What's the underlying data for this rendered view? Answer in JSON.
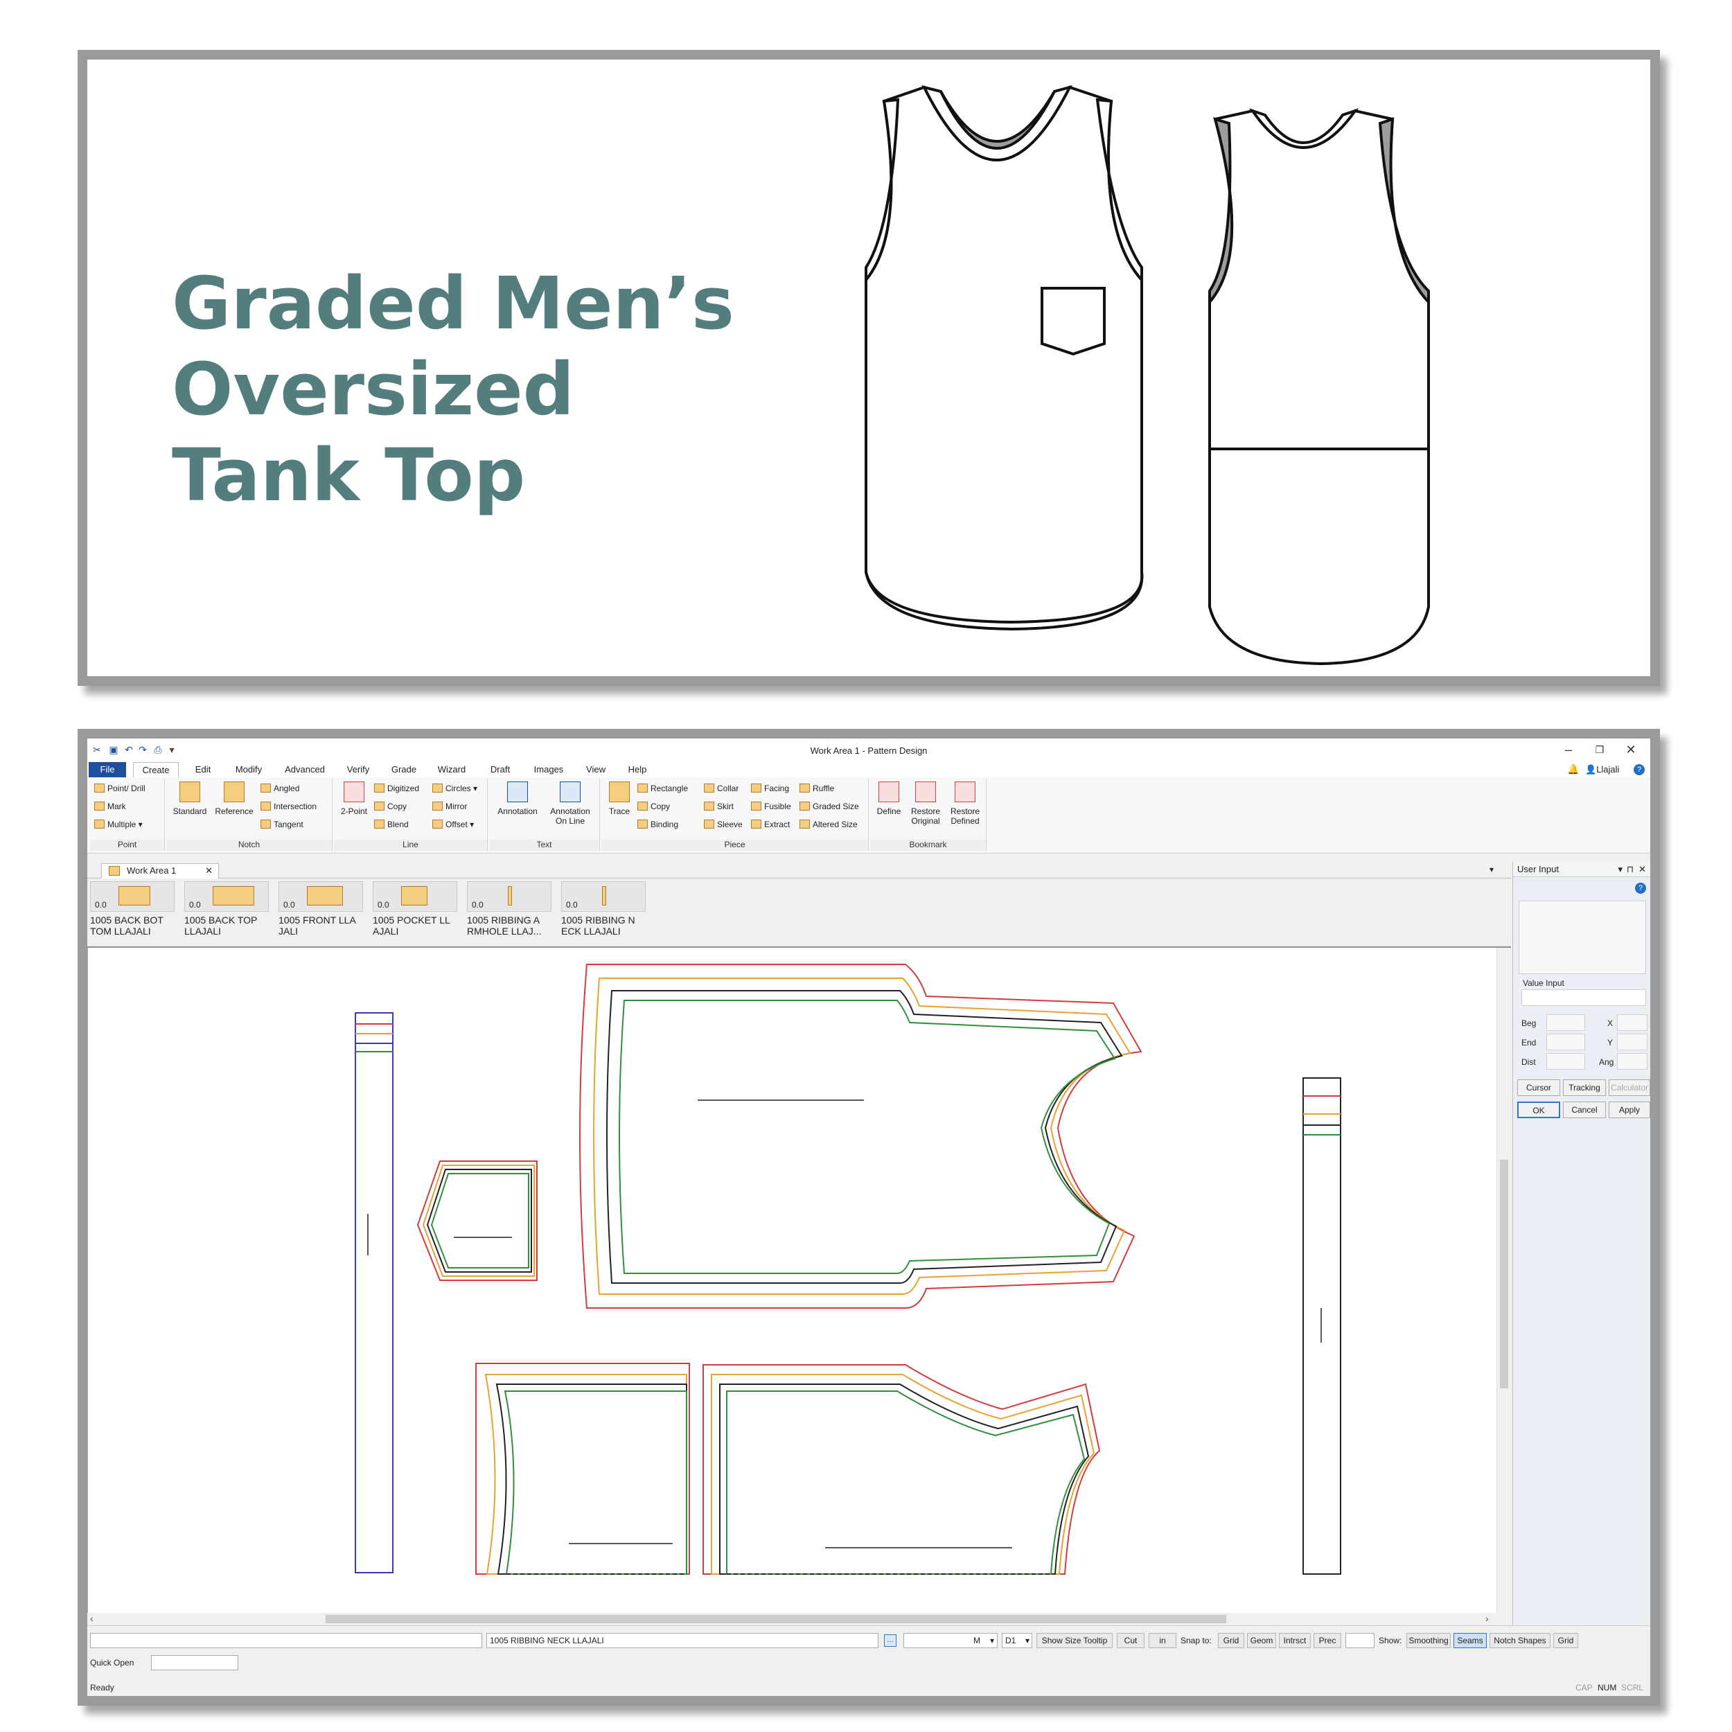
{
  "heading": {
    "line1": "Graded Men’s",
    "line2": "Oversized",
    "line3": "Tank Top"
  },
  "app": {
    "window_title": "Work Area 1 - Pattern Design",
    "user": "Llajali",
    "menus": [
      "File",
      "Create",
      "Edit",
      "Modify",
      "Advanced",
      "Verify",
      "Grade",
      "Wizard",
      "Draft",
      "Images",
      "View",
      "Help"
    ],
    "ribbon": {
      "point": {
        "label": "Point",
        "items": [
          "Point/ Drill",
          "Mark",
          "Multiple ▾"
        ]
      },
      "notch": {
        "label": "Notch",
        "standard": "Standard",
        "reference": "Reference",
        "items": [
          "Angled",
          "Intersection",
          "Tangent"
        ]
      },
      "line": {
        "label": "Line",
        "two_point": "2-Point",
        "items": [
          "Digitized",
          "Copy",
          "Blend",
          "Circles ▾",
          "Mirror",
          "Offset ▾"
        ]
      },
      "text": {
        "label": "Text",
        "annotation": "Annotation",
        "annotation_on_line_1": "Annotation",
        "annotation_on_line_2": "On Line"
      },
      "piece": {
        "label": "Piece",
        "trace": "Trace",
        "items": [
          "Rectangle",
          "Copy",
          "Binding",
          "Collar",
          "Skirt",
          "Sleeve",
          "Facing",
          "Fusible",
          "Extract",
          "Ruffle",
          "Graded Size",
          "Altered Size"
        ]
      },
      "bookmark": {
        "label": "Bookmark",
        "define": "Define",
        "restore_original_1": "Restore",
        "restore_original_2": "Original",
        "restore_defined_1": "Restore",
        "restore_defined_2": "Defined"
      }
    },
    "tab": "Work Area 1",
    "pieces": [
      {
        "value": "0.0",
        "label": "1005 BACK BOT TOM LLAJALI"
      },
      {
        "value": "0.0",
        "label": "1005 BACK TOP LLAJALI"
      },
      {
        "value": "0.0",
        "label": "1005 FRONT LLA JALI"
      },
      {
        "value": "0.0",
        "label": "1005 POCKET LL AJALI"
      },
      {
        "value": "0.0",
        "label": "1005 RIBBING A RMHOLE LLAJ..."
      },
      {
        "value": "0.0",
        "label": "1005 RIBBING N ECK LLAJALI"
      }
    ],
    "side_panel": {
      "title": "User Input",
      "value_input": "Value Input",
      "beg": "Beg",
      "end": "End",
      "dist": "Dist",
      "x": "X",
      "y": "Y",
      "ang": "Ang",
      "cursor": "Cursor",
      "tracking": "Tracking",
      "calculator": "Calculator",
      "ok": "OK",
      "cancel": "Cancel",
      "apply": "Apply"
    },
    "status": {
      "piece_name": "1005 RIBBING NECK LLAJALI",
      "size": "M",
      "rule": "D1",
      "show_size_tooltip": "Show Size Tooltip",
      "cut": "Cut",
      "unit": "in",
      "snap_to": "Snap to:",
      "snap": [
        "Grid",
        "Geom",
        "Intrsct",
        "Prec"
      ],
      "show": "Show:",
      "show_opts": [
        "Smoothing",
        "Seams",
        "Notch Shapes",
        "Grid"
      ],
      "quick_open": "Quick Open",
      "ready": "Ready",
      "cap": "CAP",
      "num": "NUM",
      "scrl": "SCRL"
    }
  },
  "colors": {
    "heading": "#547e7e",
    "file_menu": "#1f4e9c",
    "size_red": "#d23c3c",
    "size_orange": "#e8a133",
    "size_black": "#222222",
    "size_green": "#2f8f3a",
    "ribbing_blue": "#3b3bb0"
  }
}
